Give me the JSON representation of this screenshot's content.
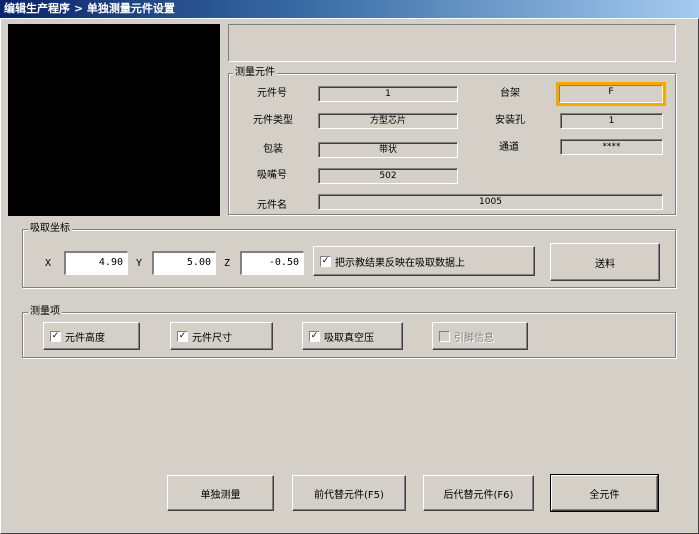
{
  "window": {
    "title": "编辑生产程序 > 单独测量元件设置"
  },
  "measure_part": {
    "legend": "测量元件",
    "fields": {
      "part_no": {
        "label": "元件号",
        "value": "1"
      },
      "rack": {
        "label": "台架",
        "value": "F"
      },
      "part_type": {
        "label": "元件类型",
        "value": "方型芯片"
      },
      "mount_hole": {
        "label": "安装孔",
        "value": "1"
      },
      "package": {
        "label": "包装",
        "value": "带状"
      },
      "channel": {
        "label": "通道",
        "value": "****"
      },
      "nozzle_no": {
        "label": "吸嘴号",
        "value": "502"
      },
      "part_name": {
        "label": "元件名",
        "value": "1005"
      }
    }
  },
  "pickup_coords": {
    "legend": "吸取坐标",
    "x": {
      "label": "X",
      "value": "4.90"
    },
    "y": {
      "label": "Y",
      "value": "5.00"
    },
    "z": {
      "label": "Z",
      "value": "-0.50"
    },
    "reflect_checkbox": {
      "label": "把示教结果反映在吸取数据上",
      "checked": true
    },
    "feed_button": "送料"
  },
  "measure_items": {
    "legend": "测量项",
    "items": [
      {
        "label": "元件高度",
        "checked": true,
        "enabled": true
      },
      {
        "label": "元件尺寸",
        "checked": true,
        "enabled": true
      },
      {
        "label": "吸取真空压",
        "checked": true,
        "enabled": true
      },
      {
        "label": "引脚信息",
        "checked": false,
        "enabled": false
      }
    ]
  },
  "footer": {
    "single_measure": "单独测量",
    "prev_part": "前代替元件(F5)",
    "next_part": "后代替元件(F6)",
    "all_parts": "全元件"
  }
}
